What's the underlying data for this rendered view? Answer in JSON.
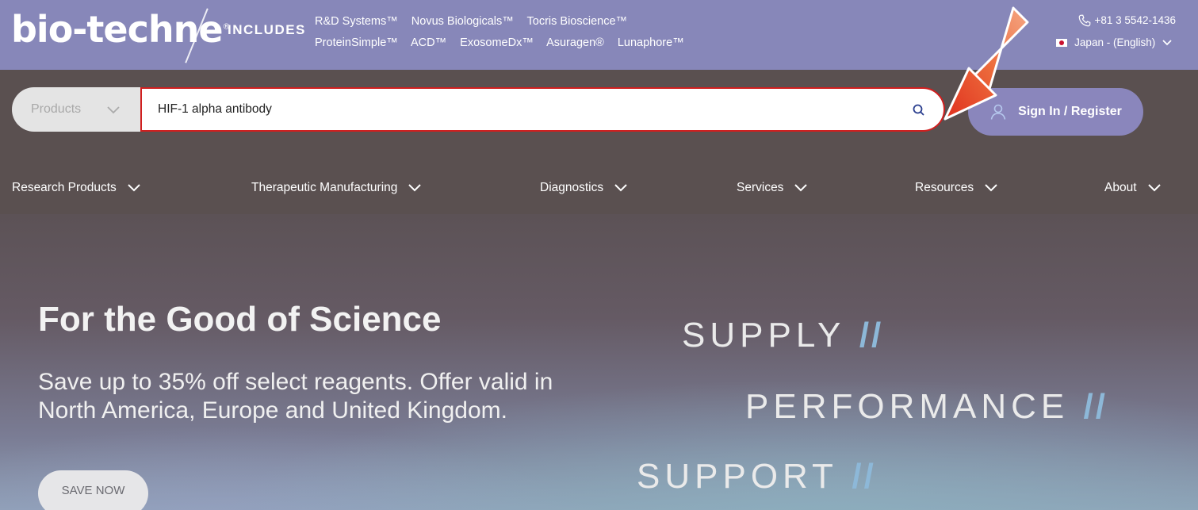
{
  "header": {
    "logo_text": "bio-techne",
    "includes_label": "INCLUDES",
    "brands_row1": [
      "R&D Systems™",
      "Novus Biologicals™",
      "Tocris Bioscience™"
    ],
    "brands_row2": [
      "ProteinSimple™",
      "ACD™",
      "ExosomeDx™",
      "Asuragen®",
      "Lunaphore™"
    ],
    "phone": "+81 3 5542-1436",
    "region": "Japan - (English)"
  },
  "search": {
    "category": "Products",
    "query": "HIF-1 alpha antibody"
  },
  "account": {
    "signin_label": "Sign In / Register"
  },
  "nav": {
    "items": [
      {
        "label": "Research Products"
      },
      {
        "label": "Therapeutic Manufacturing"
      },
      {
        "label": "Diagnostics"
      },
      {
        "label": "Services"
      },
      {
        "label": "Resources"
      },
      {
        "label": "About"
      }
    ]
  },
  "hero": {
    "title": "For the Good of Science",
    "text": "Save up to 35% off select reagents. Offer valid in North America, Europe and United Kingdom.",
    "cta": "SAVE NOW",
    "tag1": "SUPPLY",
    "tag2": "PERFORMANCE",
    "tag3": "SUPPORT",
    "separator": "//"
  },
  "colors": {
    "brand_purple": "#8787b9",
    "dark_bar": "#5a5050",
    "highlight_red": "#d01f1f",
    "arrow_orange": "#e8572a",
    "slash_blue": "#8db8d8"
  }
}
